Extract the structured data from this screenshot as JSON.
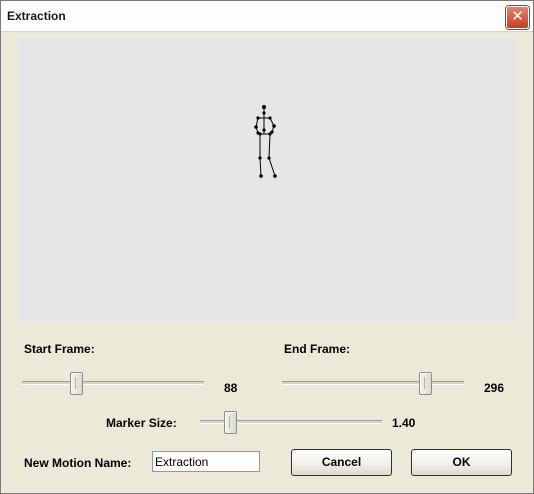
{
  "window": {
    "title": "Extraction",
    "close_glyph": "✕"
  },
  "icons": {
    "close": "close-icon"
  },
  "start_frame": {
    "label": "Start Frame:",
    "value": "88",
    "position": 0.285
  },
  "end_frame": {
    "label": "End Frame:",
    "value": "296",
    "position": 0.81
  },
  "marker_size": {
    "label": "Marker Size:",
    "value": "1.40",
    "position": 0.14
  },
  "motion_name": {
    "label": "New Motion Name:",
    "value": "Extraction"
  },
  "buttons": {
    "cancel": "Cancel",
    "ok": "OK"
  }
}
